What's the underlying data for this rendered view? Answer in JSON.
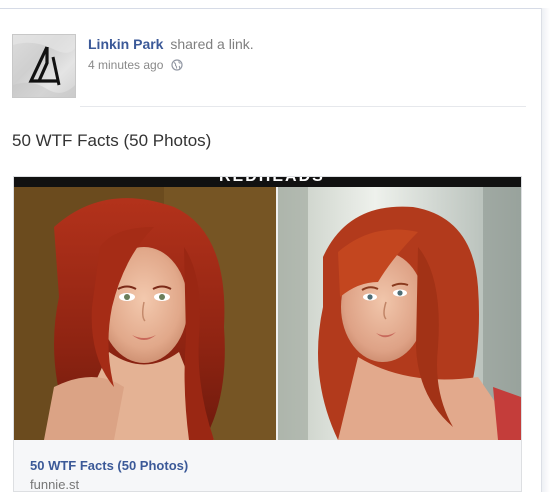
{
  "post": {
    "author": "Linkin Park",
    "action": "shared a link.",
    "timestamp": "4 minutes ago",
    "privacy_icon": "globe-icon",
    "text": "50 WTF Facts (50 Photos)"
  },
  "link_preview": {
    "banner_text": "REDHEADS",
    "title": "50 WTF Facts (50 Photos)",
    "domain": "funnie.st",
    "left_image": "redhead-photo-left",
    "right_image": "redhead-photo-right"
  },
  "colors": {
    "link_blue": "#3b5998",
    "meta_gray": "#8a8a8a",
    "text_dark": "#333333"
  }
}
